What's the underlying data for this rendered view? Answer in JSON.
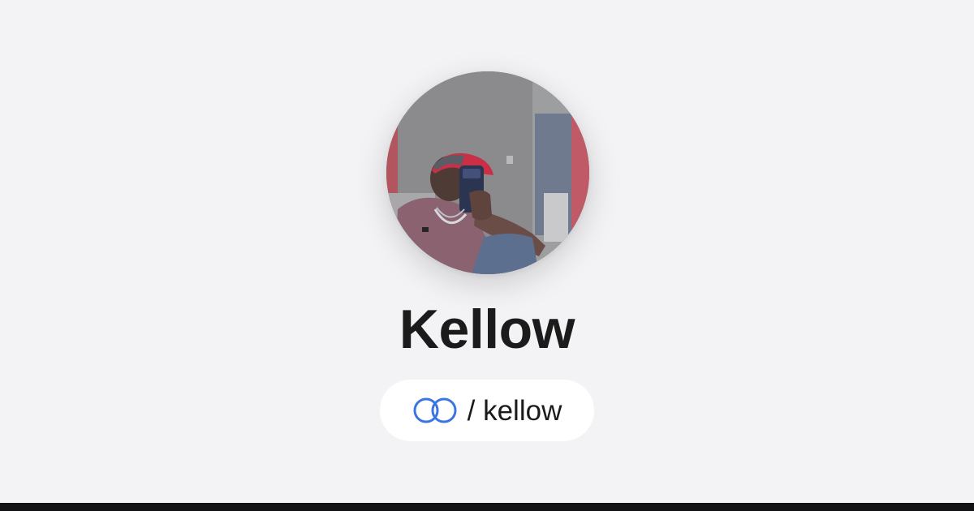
{
  "profile": {
    "display_name": "Kellow",
    "handle": "/ kellow",
    "avatar_alt": "profile-photo"
  },
  "brand": {
    "logo_icon": "linked-rings-logo-icon",
    "logo_color": "#3b76e0"
  },
  "colors": {
    "background": "#f3f3f6",
    "pill_background": "#ffffff",
    "text": "#1b1b1c",
    "bottom_bar": "#121214"
  }
}
